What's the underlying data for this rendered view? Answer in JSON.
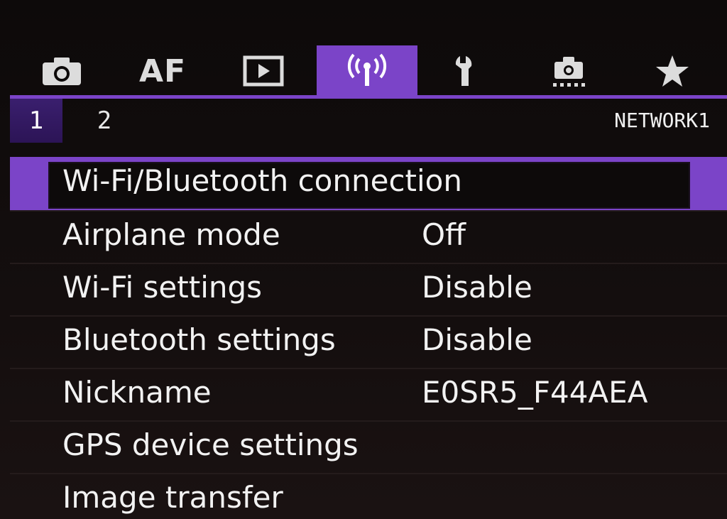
{
  "tabs": [
    {
      "icon": "camera-icon",
      "label": ""
    },
    {
      "icon": "af-text",
      "label": "AF"
    },
    {
      "icon": "playback-icon",
      "label": ""
    },
    {
      "icon": "wireless-icon",
      "label": "",
      "active": true
    },
    {
      "icon": "wrench-icon",
      "label": ""
    },
    {
      "icon": "custom-function-icon",
      "label": ""
    },
    {
      "icon": "star-icon",
      "label": ""
    }
  ],
  "pages": [
    "1",
    "2"
  ],
  "page_title": "NETWORK1",
  "menu": [
    {
      "label": "Wi-Fi/Bluetooth connection",
      "value": ""
    },
    {
      "label": "Airplane mode",
      "value": "Off"
    },
    {
      "label": "Wi-Fi settings",
      "value": "Disable"
    },
    {
      "label": "Bluetooth settings",
      "value": "Disable"
    },
    {
      "label": "Nickname",
      "value": "E0SR5_F44AEA"
    },
    {
      "label": "GPS device settings",
      "value": ""
    },
    {
      "label": "Image transfer",
      "value": ""
    }
  ],
  "colors": {
    "accent": "#7b44c8",
    "background": "#0d0a0a",
    "text": "#f2f2f2"
  }
}
